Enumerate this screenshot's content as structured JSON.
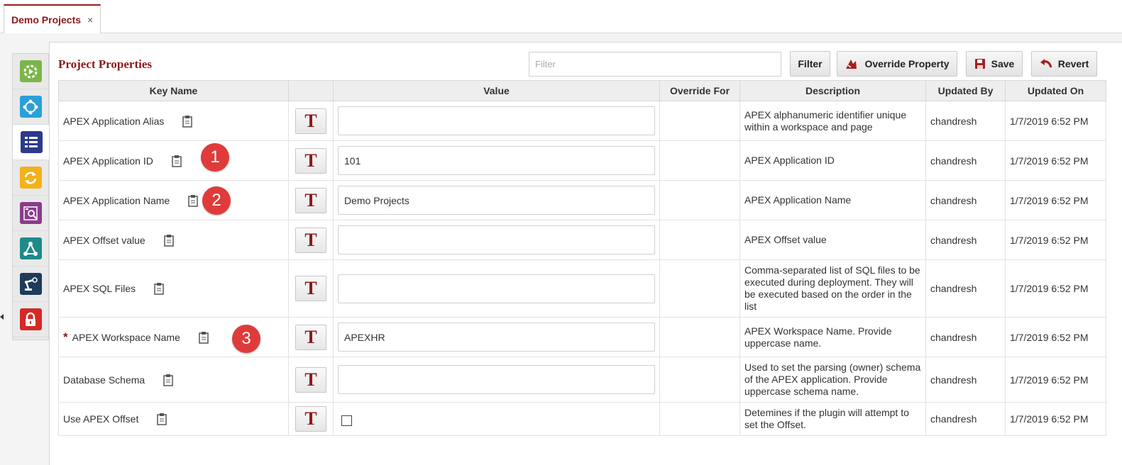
{
  "tab": {
    "title": "Demo Projects",
    "close": "×"
  },
  "sidebar": [
    {
      "icon": "run-icon",
      "color": "#7ab648"
    },
    {
      "icon": "network-icon",
      "color": "#2aa0d8"
    },
    {
      "icon": "properties-list-icon",
      "color": "#2c3a8c"
    },
    {
      "icon": "refresh-icon",
      "color": "#f2b21b"
    },
    {
      "icon": "inspect-icon",
      "color": "#8b3a8b"
    },
    {
      "icon": "workflow-icon",
      "color": "#1f8a8a"
    },
    {
      "icon": "robot-arm-icon",
      "color": "#1e3c5a"
    },
    {
      "icon": "lock-icon",
      "color": "#d72828"
    }
  ],
  "panel": {
    "title": "Project Properties",
    "filter_placeholder": "Filter",
    "buttons": {
      "filter": "Filter",
      "override": "Override Property",
      "save": "Save",
      "revert": "Revert"
    }
  },
  "columns": [
    "Key Name",
    "",
    "Value",
    "Override For",
    "Description",
    "Updated By",
    "Updated On"
  ],
  "rows": [
    {
      "key": "APEX Application Alias",
      "required": false,
      "value": "",
      "override_for": "",
      "description": "APEX alphanumeric identifier unique within a workspace and page",
      "updated_by": "chandresh",
      "updated_on": "1/7/2019 6:52 PM"
    },
    {
      "key": "APEX Application ID",
      "required": false,
      "value": "101",
      "override_for": "",
      "description": "APEX Application ID",
      "updated_by": "chandresh",
      "updated_on": "1/7/2019 6:52 PM",
      "callout": "1"
    },
    {
      "key": "APEX Application Name",
      "required": false,
      "value": "Demo Projects",
      "override_for": "",
      "description": "APEX Application Name",
      "updated_by": "chandresh",
      "updated_on": "1/7/2019 6:52 PM",
      "callout": "2"
    },
    {
      "key": "APEX Offset value",
      "required": false,
      "value": "",
      "override_for": "",
      "description": "APEX Offset value",
      "updated_by": "chandresh",
      "updated_on": "1/7/2019 6:52 PM"
    },
    {
      "key": "APEX SQL Files",
      "required": false,
      "value": "",
      "override_for": "",
      "description": "Comma-separated list of SQL files to be executed during deployment. They will be executed based on the order in the list",
      "updated_by": "chandresh",
      "updated_on": "1/7/2019 6:52 PM"
    },
    {
      "key": "APEX Workspace Name",
      "required": true,
      "required_mark": "*",
      "value": "APEXHR",
      "override_for": "",
      "description": "APEX Workspace Name. Provide uppercase name.",
      "updated_by": "chandresh",
      "updated_on": "1/7/2019 6:52 PM",
      "callout": "3"
    },
    {
      "key": "Database Schema",
      "required": false,
      "value": "",
      "override_for": "",
      "description": "Used to set the parsing (owner) schema of the APEX application. Provide uppercase schema name.",
      "updated_by": "chandresh",
      "updated_on": "1/7/2019 6:52 PM"
    },
    {
      "key": "Use APEX Offset",
      "required": false,
      "value_type": "checkbox",
      "checked": false,
      "override_for": "",
      "description": "Detemines if the plugin will attempt to set the Offset.",
      "updated_by": "chandresh",
      "updated_on": "1/7/2019 6:52 PM"
    }
  ],
  "type_button_label": "T"
}
